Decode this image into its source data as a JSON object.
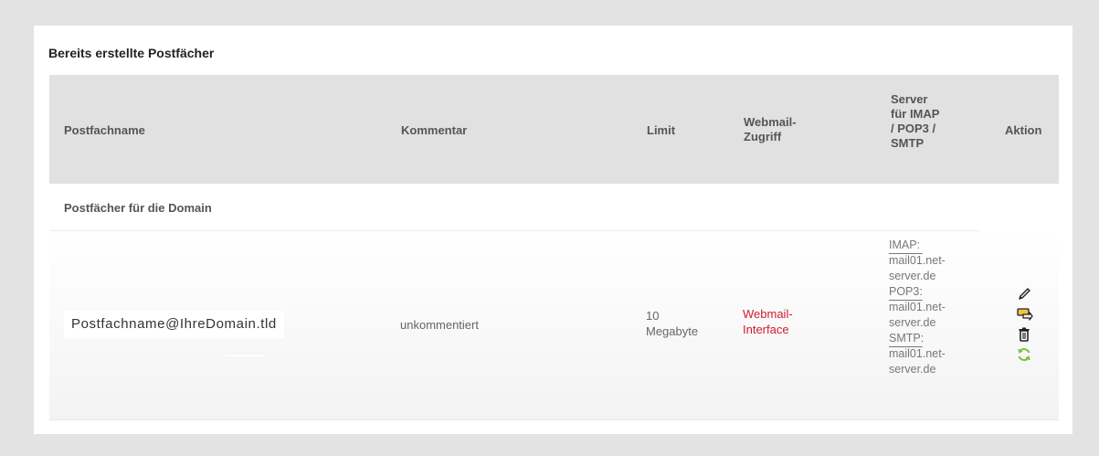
{
  "panel": {
    "title": "Bereits erstellte Postfächer"
  },
  "table": {
    "headers": {
      "name": "Postfachname",
      "comment": "Kommentar",
      "limit": "Limit",
      "webmail": [
        "Webmail-",
        "Zugriff"
      ],
      "server": [
        "Server",
        "für IMAP",
        "/ POP3 /",
        "SMTP"
      ],
      "action": "Aktion"
    },
    "section_label": "Postfächer für die Domain",
    "rows": [
      {
        "name": "Postfachname@IhreDomain.tld",
        "comment": "unkommentiert",
        "limit": [
          "10",
          "Megabyte"
        ],
        "webmail": [
          "Webmail-",
          "Interface"
        ],
        "server": {
          "imap_label": "IMAP:",
          "imap_host": [
            "mail01",
            ".net-",
            "server.de"
          ],
          "pop3_label": "POP3:",
          "pop3_host": [
            "mail01",
            ".net-",
            "server.de"
          ],
          "smtp_label": "SMTP:",
          "smtp_host": [
            "mail01",
            ".net-",
            "server.de"
          ]
        },
        "actions": [
          "edit-icon",
          "forward-icon",
          "delete-icon",
          "refresh-icon"
        ]
      }
    ]
  },
  "colors": {
    "link": "#d01c2c",
    "header_bg": "#e1e1e1",
    "page_bg": "#e3e3e3",
    "refresh": "#7cc242"
  }
}
